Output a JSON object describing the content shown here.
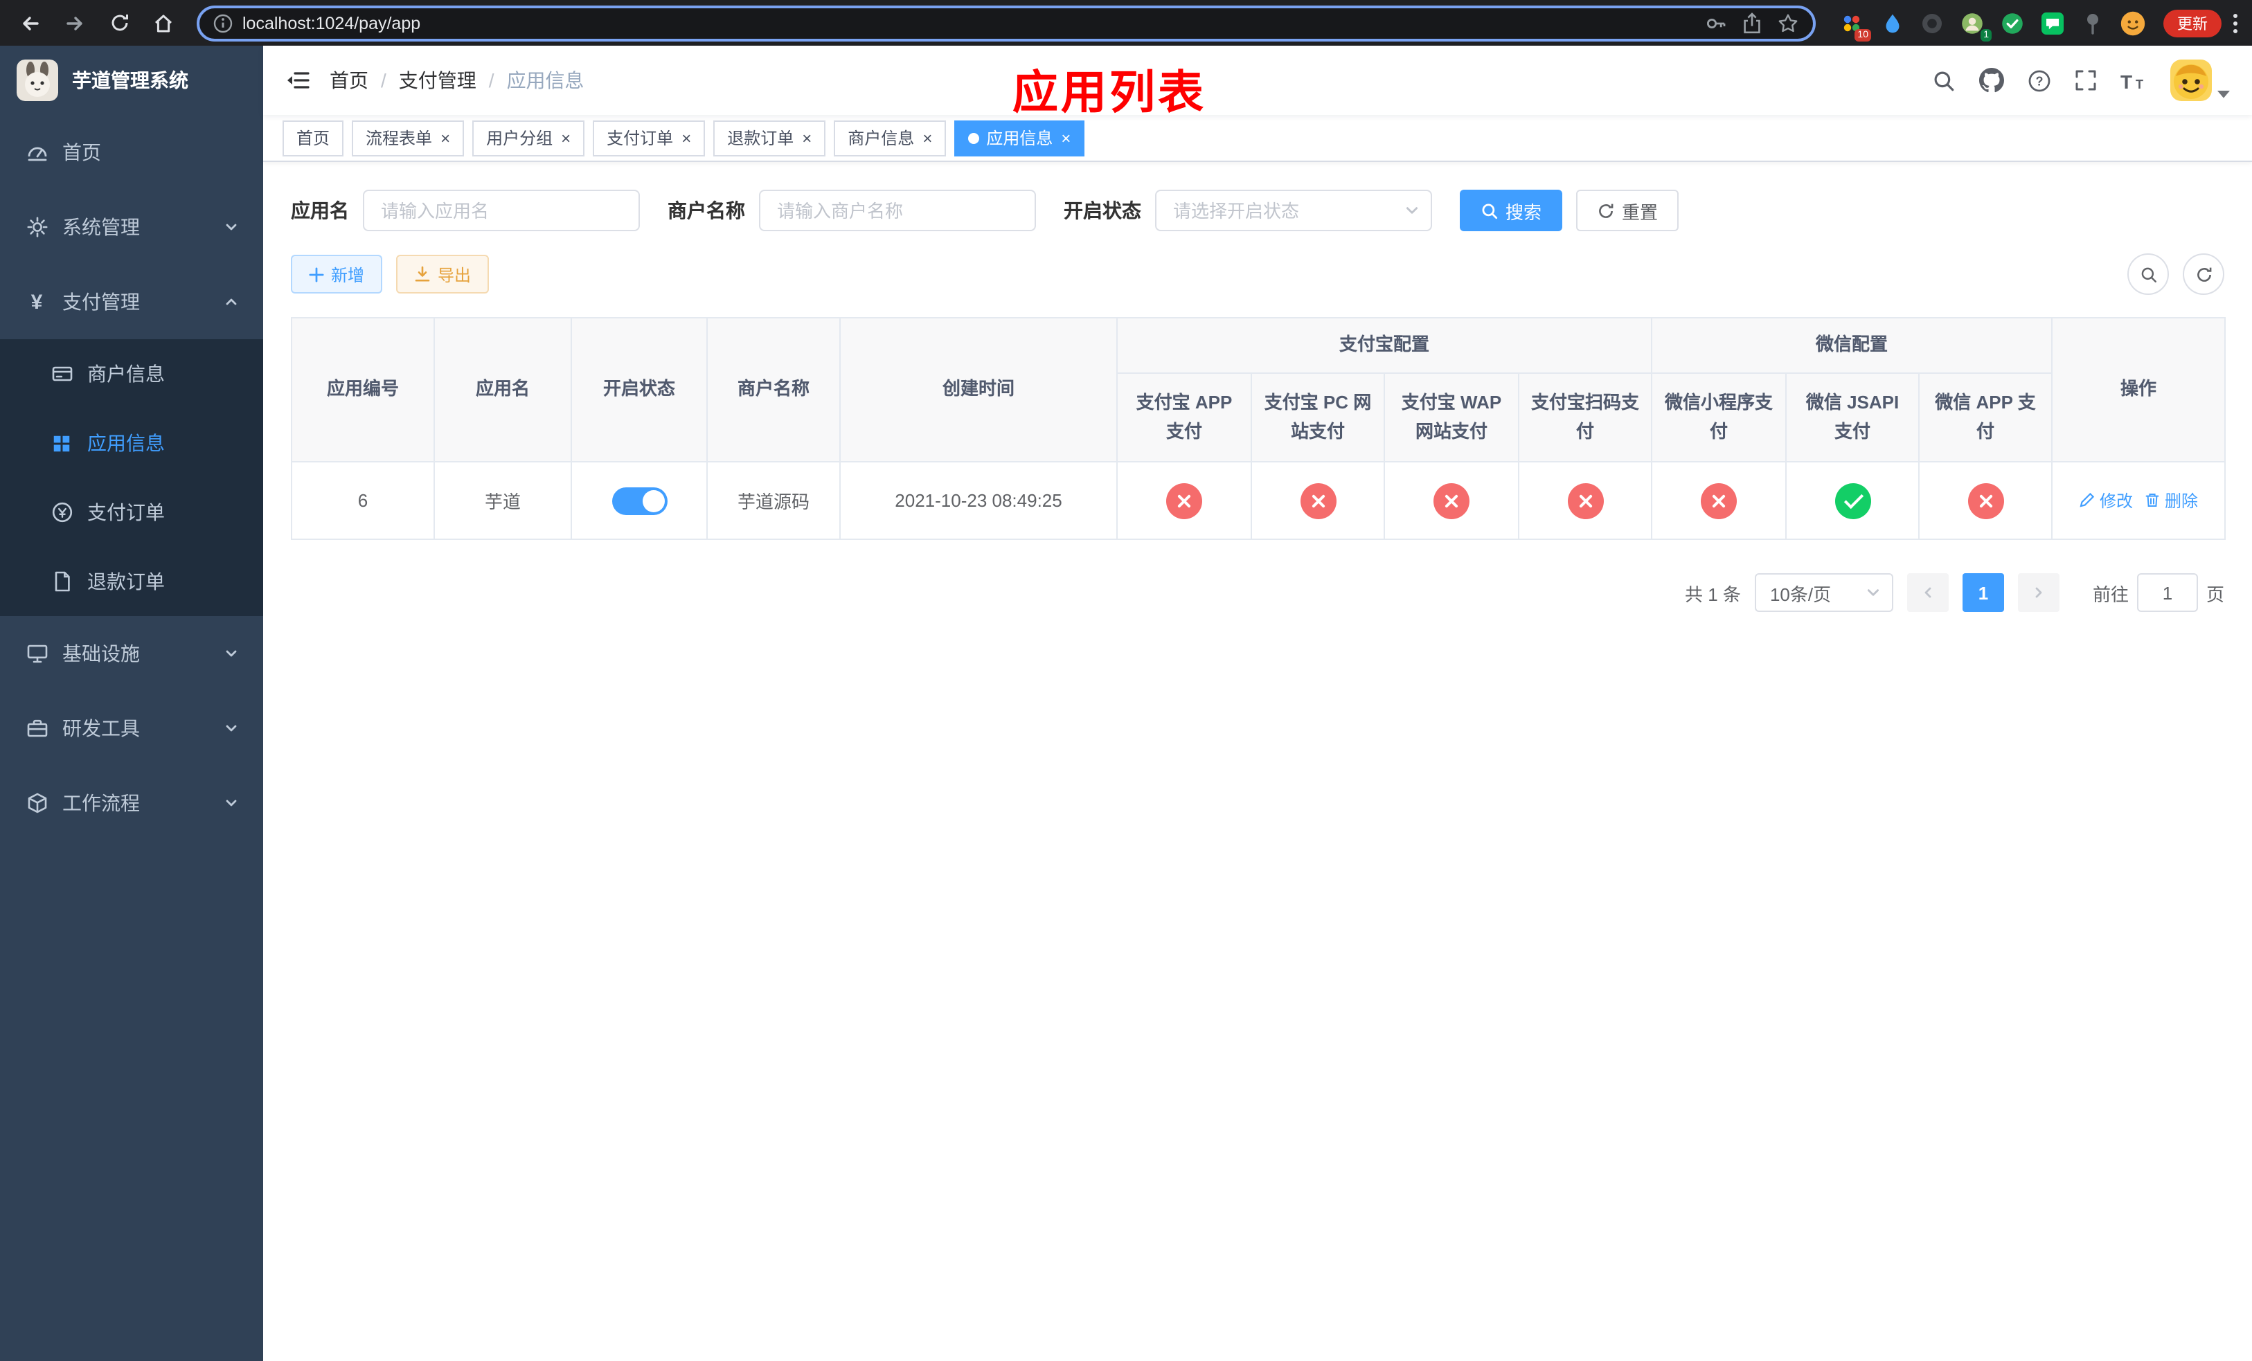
{
  "browser": {
    "url": "localhost:1024/pay/app",
    "update_label": "更新",
    "extension_badge_count": "10",
    "profile_badge_count": "1"
  },
  "sidebar": {
    "title": "芋道管理系统",
    "items": [
      "首页",
      "系统管理",
      "支付管理",
      "基础设施",
      "研发工具",
      "工作流程"
    ],
    "payment_children": [
      "商户信息",
      "应用信息",
      "支付订单",
      "退款订单"
    ]
  },
  "navbar": {
    "breadcrumb": [
      "首页",
      "支付管理",
      "应用信息"
    ],
    "annotation": "应用列表"
  },
  "tabs": [
    {
      "label": "首页",
      "closable": false,
      "active": false
    },
    {
      "label": "流程表单",
      "closable": true,
      "active": false
    },
    {
      "label": "用户分组",
      "closable": true,
      "active": false
    },
    {
      "label": "支付订单",
      "closable": true,
      "active": false
    },
    {
      "label": "退款订单",
      "closable": true,
      "active": false
    },
    {
      "label": "商户信息",
      "closable": true,
      "active": false
    },
    {
      "label": "应用信息",
      "closable": true,
      "active": true
    }
  ],
  "filter": {
    "fields": [
      {
        "label": "应用名",
        "placeholder": "请输入应用名"
      },
      {
        "label": "商户名称",
        "placeholder": "请输入商户名称"
      },
      {
        "label": "开启状态",
        "placeholder": "请选择开启状态"
      }
    ],
    "search_label": "搜索",
    "reset_label": "重置"
  },
  "toolbar": {
    "add_label": "新增",
    "export_label": "导出"
  },
  "table": {
    "columns": {
      "id": "应用编号",
      "name": "应用名",
      "status": "开启状态",
      "merchant": "商户名称",
      "created": "创建时间",
      "op": "操作"
    },
    "groups": [
      {
        "label": "支付宝配置",
        "children": [
          "支付宝 APP 支付",
          "支付宝 PC 网站支付",
          "支付宝 WAP 网站支付",
          "支付宝扫码支付"
        ]
      },
      {
        "label": "微信配置",
        "children": [
          "微信小程序支付",
          "微信 JSAPI 支付",
          "微信 APP 支付"
        ]
      }
    ],
    "row": {
      "id": "6",
      "name": "芋道",
      "enabled": true,
      "merchant": "芋道源码",
      "created": "2021-10-23 08:49:25",
      "pay_flags": [
        false,
        false,
        false,
        false,
        false,
        true,
        false
      ],
      "edit_label": "修改",
      "delete_label": "删除"
    }
  },
  "pagination": {
    "total": "共 1 条",
    "page_size": "10条/页",
    "page": "1",
    "goto_prefix": "前往",
    "goto_value": "1",
    "goto_suffix": "页"
  }
}
